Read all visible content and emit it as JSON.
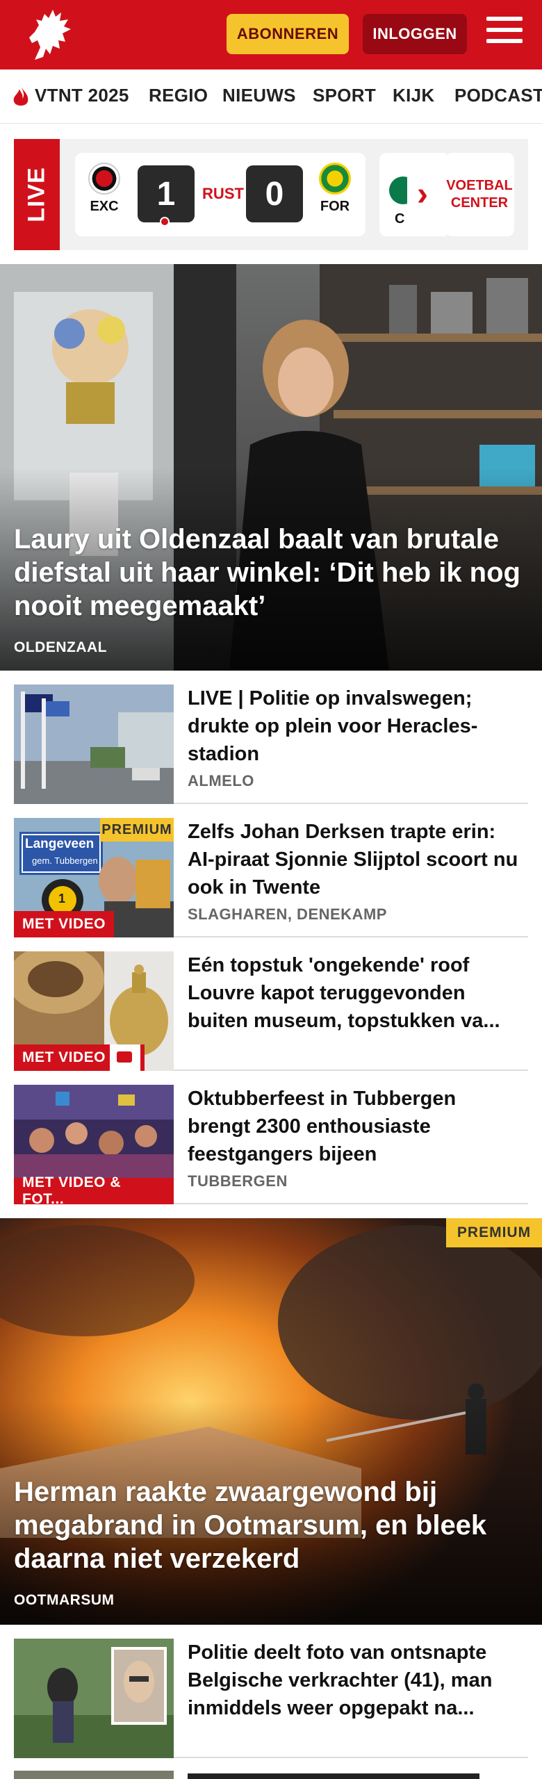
{
  "header": {
    "subscribe_label": "ABONNEREN",
    "login_label": "INLOGGEN"
  },
  "nav": {
    "items": [
      "VTNT 2025",
      "REGIO",
      "NIEUWS",
      "SPORT",
      "KIJK",
      "PODCAST"
    ]
  },
  "live": {
    "label": "LIVE",
    "match": {
      "home_abbr": "EXC",
      "home_score": "1",
      "status": "RUST",
      "away_score": "0",
      "away_abbr": "FOR"
    },
    "next_abbr": "C",
    "voetbal_center": "VOETBAL CENTER"
  },
  "hero1": {
    "title": "Laury uit Oldenzaal baalt van brutale diefstal uit haar winkel: ‘Dit heb ik nog nooit meegemaakt’",
    "location": "OLDENZAAL"
  },
  "articles": [
    {
      "title": "LIVE | Politie op invalswegen; drukte op plein voor Heracles-stadion",
      "location": "ALMELO"
    },
    {
      "title": "Zelfs Johan Derksen trapte erin: AI-piraat Sjonnie Slijptol scoort nu ook in Twente",
      "location": "SLAGHAREN, DENEKAMP",
      "premium": "PREMIUM",
      "badge": "MET VIDEO",
      "thumb_sign": "Langeveen",
      "thumb_sign2": "gem. Tubbergen"
    },
    {
      "title": "Eén topstuk 'ongekende' roof Louvre kapot teruggevonden buiten museum, topstukken va...",
      "badge": "MET VIDEO"
    },
    {
      "title": "Oktubberfeest in Tubbergen brengt 2300 enthousiaste feestgangers bijeen",
      "location": "TUBBERGEN",
      "badge": "MET VIDEO & FOT..."
    }
  ],
  "hero2": {
    "title": "Herman raakte zwaargewond bij megabrand in Ootmarsum, en bleek daarna niet verzekerd",
    "location": "OOTMARSUM",
    "premium": "PREMIUM"
  },
  "article_last": {
    "title": "Politie deelt foto van ontsnapte Belgische verkrachter (41), man inmiddels weer opgepakt na..."
  },
  "colors": {
    "brand_red": "#d0111b",
    "premium_yellow": "#f5c42c",
    "login_dark_red": "#980913"
  }
}
